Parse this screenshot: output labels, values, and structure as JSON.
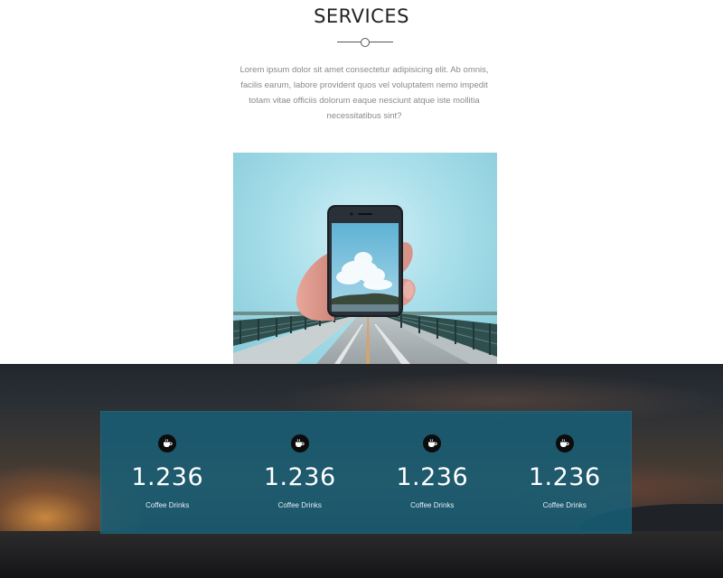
{
  "services": {
    "title": "SERVICES",
    "text": "Lorem ipsum dolor sit amet consectetur adipisicing elit. Ab omnis, facilis earum, labore provident quos vel voluptatem nemo impedit totam vitae officiis dolorum eaque nesciunt atque iste mollitia necessitatibus sint?"
  },
  "stats": [
    {
      "icon": "coffee-cup-icon",
      "value": "1.236",
      "label": "Coffee Drinks"
    },
    {
      "icon": "coffee-cup-icon",
      "value": "1.236",
      "label": "Coffee Drinks"
    },
    {
      "icon": "coffee-cup-icon",
      "value": "1.236",
      "label": "Coffee Drinks"
    },
    {
      "icon": "coffee-cup-icon",
      "value": "1.236",
      "label": "Coffee Drinks"
    }
  ],
  "colors": {
    "stats_panel": "#16607a",
    "icon_circle": "#0c0c0c",
    "title_text": "#222222",
    "body_text": "#8a8a8a"
  }
}
